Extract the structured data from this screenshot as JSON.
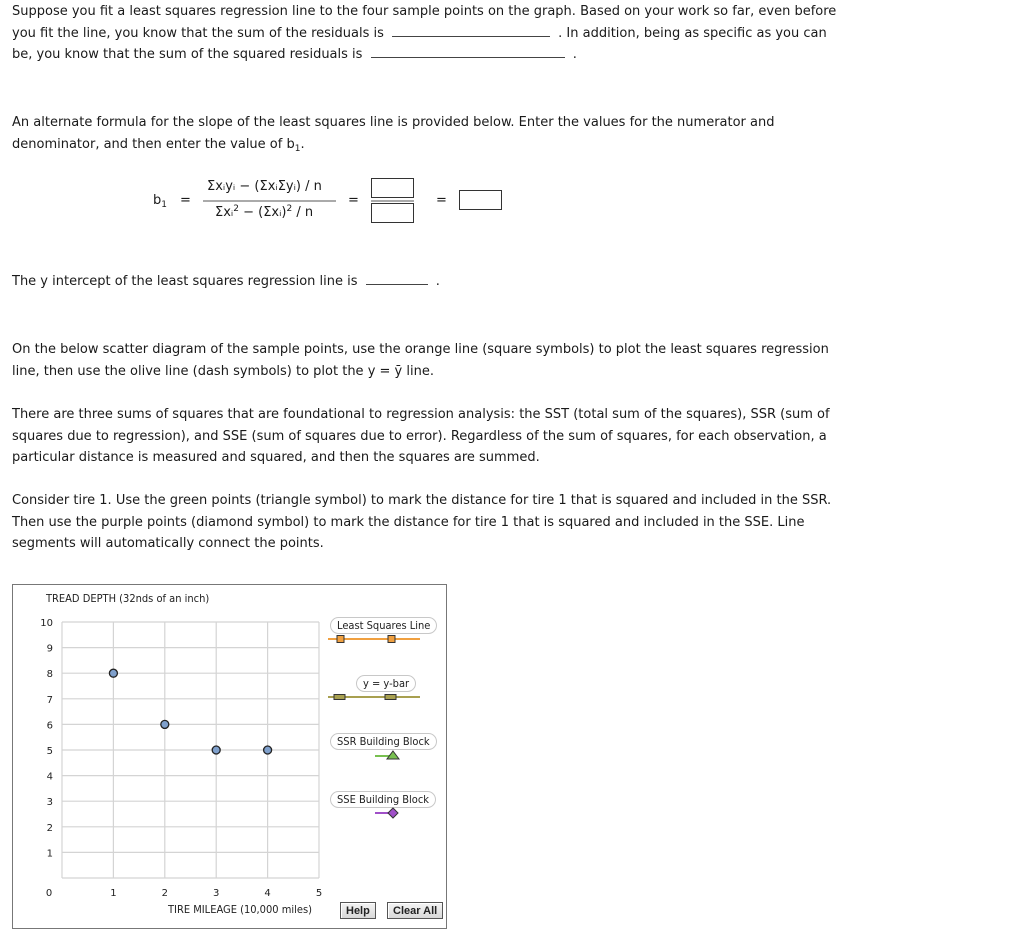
{
  "q1": {
    "part1": "Suppose you fit a least squares regression line to the four sample points on the graph. Based on your work so far, even before you fit the line, you know that the sum of the residuals is",
    "part2": ". In addition, being as specific as you can be, you know that the sum of the squared residuals is",
    "part3": ".",
    "sum_residuals_value": "",
    "sum_squared_residuals_value": ""
  },
  "q2": {
    "text_a": "An alternate formula for the slope of the least squares line is provided below. Enter the values for the numerator and denominator, and then enter the value of b",
    "text_sub": "1",
    "text_end": "."
  },
  "formula": {
    "lhs": "b",
    "lhs_sub": "1",
    "equals": "=",
    "numerator": "Σxᵢyᵢ − (ΣxᵢΣyᵢ) / n",
    "denominator_a": "Σxᵢ",
    "denominator_sup": "2",
    "denominator_b": " − (Σxᵢ)",
    "denominator_sup2": "2",
    "denominator_c": " / n",
    "numerator_value": "",
    "denominator_value": "",
    "result_value": ""
  },
  "q3": {
    "text": "The y intercept of the least squares regression line is",
    "end": ".",
    "value": ""
  },
  "q4": {
    "text": "On the below scatter diagram of the sample points, use the orange line (square symbols) to plot the least squares regression line, then use the olive line (dash symbols) to plot the y = ȳ line."
  },
  "q5": {
    "text": "There are three sums of squares that are foundational to regression analysis: the SST (total sum of the squares), SSR (sum of squares due to regression), and SSE (sum of squares due to error). Regardless of the sum of squares, for each observation, a particular distance is measured and squared, and then the squares are summed."
  },
  "q6": {
    "text": "Consider tire 1. Use the green points (triangle symbol) to mark the distance for tire 1 that is squared and included in the SSR. Then use the purple points (diamond symbol) to mark the distance for tire 1 that is squared and included in the SSE. Line segments will automatically connect the points."
  },
  "graph": {
    "legend": {
      "least_squares": "Least Squares Line",
      "ybar": "y = y-bar",
      "ssr": "SSR Building Block",
      "sse": "SSE Building Block"
    },
    "buttons": {
      "help": "Help",
      "clear_all": "Clear All"
    },
    "colors": {
      "least_squares": "#f0a040",
      "ybar": "#a8a050",
      "ssr": "#78c050",
      "sse": "#a050c8",
      "point": "#7fa0cc",
      "grid": "#d4d4d4"
    }
  },
  "chart_data": {
    "type": "scatter",
    "xlabel": "TIRE MILEAGE (10,000 miles)",
    "ylabel": "TREAD DEPTH (32nds of an inch)",
    "xlim": [
      0,
      5
    ],
    "ylim": [
      0,
      10
    ],
    "x_ticks": [
      "0",
      "1",
      "2",
      "3",
      "4",
      "5"
    ],
    "y_ticks": [
      "1",
      "2",
      "3",
      "4",
      "5",
      "6",
      "7",
      "8",
      "9",
      "10"
    ],
    "grid": true,
    "points": [
      {
        "x": 1,
        "y": 8
      },
      {
        "x": 2,
        "y": 6
      },
      {
        "x": 3,
        "y": 5
      },
      {
        "x": 4,
        "y": 5
      }
    ]
  }
}
